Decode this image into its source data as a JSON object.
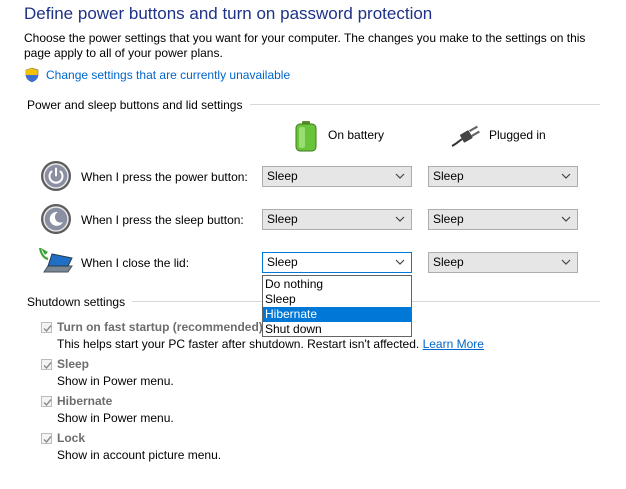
{
  "page": {
    "title": "Define power buttons and turn on password protection",
    "intro": "Choose the power settings that you want for your computer. The changes you make to the settings on this page apply to all of your power plans.",
    "change_link": "Change settings that are currently unavailable"
  },
  "power_section": {
    "heading": "Power and sleep buttons and lid settings",
    "col_battery": "On battery",
    "col_plugged": "Plugged in",
    "rows": [
      {
        "label": "When I press the power button:",
        "battery": "Sleep",
        "plugged": "Sleep",
        "icon": "power-button-icon"
      },
      {
        "label": "When I press the sleep button:",
        "battery": "Sleep",
        "plugged": "Sleep",
        "icon": "sleep-button-icon"
      },
      {
        "label": "When I close the lid:",
        "battery": "Sleep",
        "plugged": "Sleep",
        "icon": "laptop-lid-icon"
      }
    ],
    "open_dropdown_options": [
      "Do nothing",
      "Sleep",
      "Hibernate",
      "Shut down"
    ],
    "highlighted_option": "Hibernate"
  },
  "shutdown_section": {
    "heading": "Shutdown settings",
    "items": [
      {
        "label": "Turn on fast startup (recommended)",
        "desc": "This helps start your PC faster after shutdown. Restart isn't affected.",
        "link": "Learn More",
        "checked": true
      },
      {
        "label": "Sleep",
        "desc": "Show in Power menu.",
        "checked": true
      },
      {
        "label": "Hibernate",
        "desc": "Show in Power menu.",
        "checked": true
      },
      {
        "label": "Lock",
        "desc": "Show in account picture menu.",
        "checked": true
      }
    ]
  },
  "colors": {
    "title": "#1e3287",
    "link": "#0066cc",
    "selection": "#0078d7",
    "disabled_text": "#6d6d6d"
  }
}
